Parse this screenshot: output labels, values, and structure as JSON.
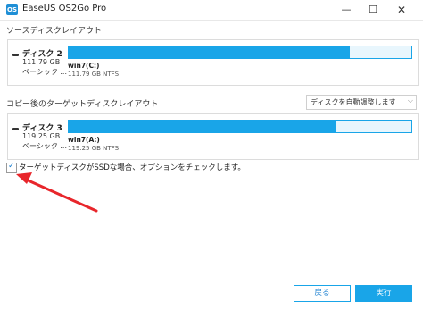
{
  "window": {
    "logo_text": "OS",
    "title": "EaseUS OS2Go Pro",
    "minimize": "—",
    "maximize": "☐",
    "close": "✕"
  },
  "source": {
    "label": "ソースディスクレイアウト",
    "disk": {
      "name": "ディスク 2",
      "size": "111.79 GB",
      "type": "ベーシック ...",
      "partition_name": "win7(C:)",
      "partition_info": "111.79 GB NTFS",
      "used_fraction": 0.82
    }
  },
  "target": {
    "label": "コピー後のターゲットディスクレイアウト",
    "dropdown_value": "ディスクを自動調整します",
    "disk": {
      "name": "ディスク 3",
      "size": "119.25 GB",
      "type": "ベーシック ...",
      "partition_name": "win7(A:)",
      "partition_info": "119.25 GB NTFS",
      "used_fraction": 0.78
    }
  },
  "ssd_option": {
    "checked": true,
    "label": "ターゲットディスクがSSDな場合、オプションをチェックします。"
  },
  "buttons": {
    "back": "戻る",
    "execute": "実行"
  },
  "colors": {
    "accent": "#19a5e8",
    "annotation_arrow": "#e8262b"
  }
}
